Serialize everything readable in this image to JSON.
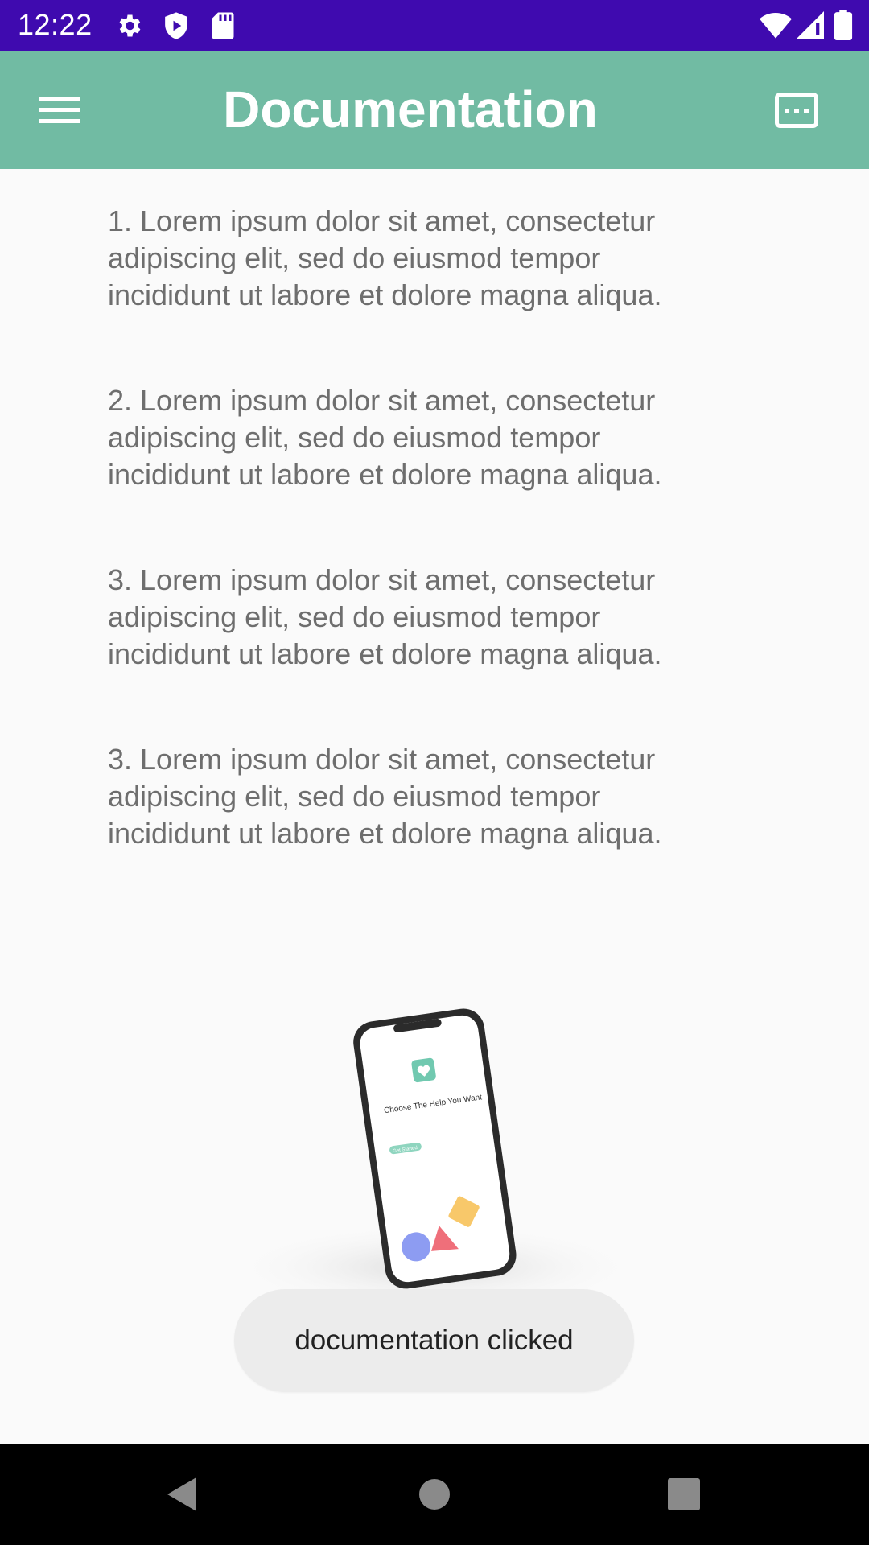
{
  "status_bar": {
    "time": "12:22",
    "icons_left": [
      "settings-icon",
      "shield-play-icon",
      "sd-card-icon"
    ],
    "icons_right": [
      "wifi-icon",
      "signal-icon",
      "battery-icon"
    ],
    "background": "#3f0aaf"
  },
  "app_bar": {
    "title": "Documentation",
    "left_icon": "menu-icon",
    "right_icon": "subtitles-icon",
    "background": "#71bba3"
  },
  "content": {
    "paragraphs": [
      "1. Lorem ipsum dolor sit amet, consectetur\nadipiscing elit, sed do eiusmod tempor\nincididunt ut labore et dolore magna aliqua.",
      "2. Lorem ipsum dolor sit amet, consectetur\nadipiscing elit, sed do eiusmod tempor\nincididunt ut labore et dolore magna aliqua.",
      "3. Lorem ipsum dolor sit amet, consectetur\nadipiscing elit, sed do eiusmod tempor\nincididunt ut labore et dolore magna aliqua.",
      "3. Lorem ipsum dolor sit amet, consectetur\nadipiscing elit, sed do eiusmod tempor\nincididunt ut labore et dolore magna aliqua."
    ],
    "text_color": "#6e6e6e"
  },
  "illustration": {
    "phone_heading": "Choose The Help You Want",
    "phone_button": "Get Started"
  },
  "toast": {
    "message": "documentation clicked"
  },
  "nav_bar": {
    "icons": [
      "back-icon",
      "home-icon",
      "recents-icon"
    ]
  }
}
